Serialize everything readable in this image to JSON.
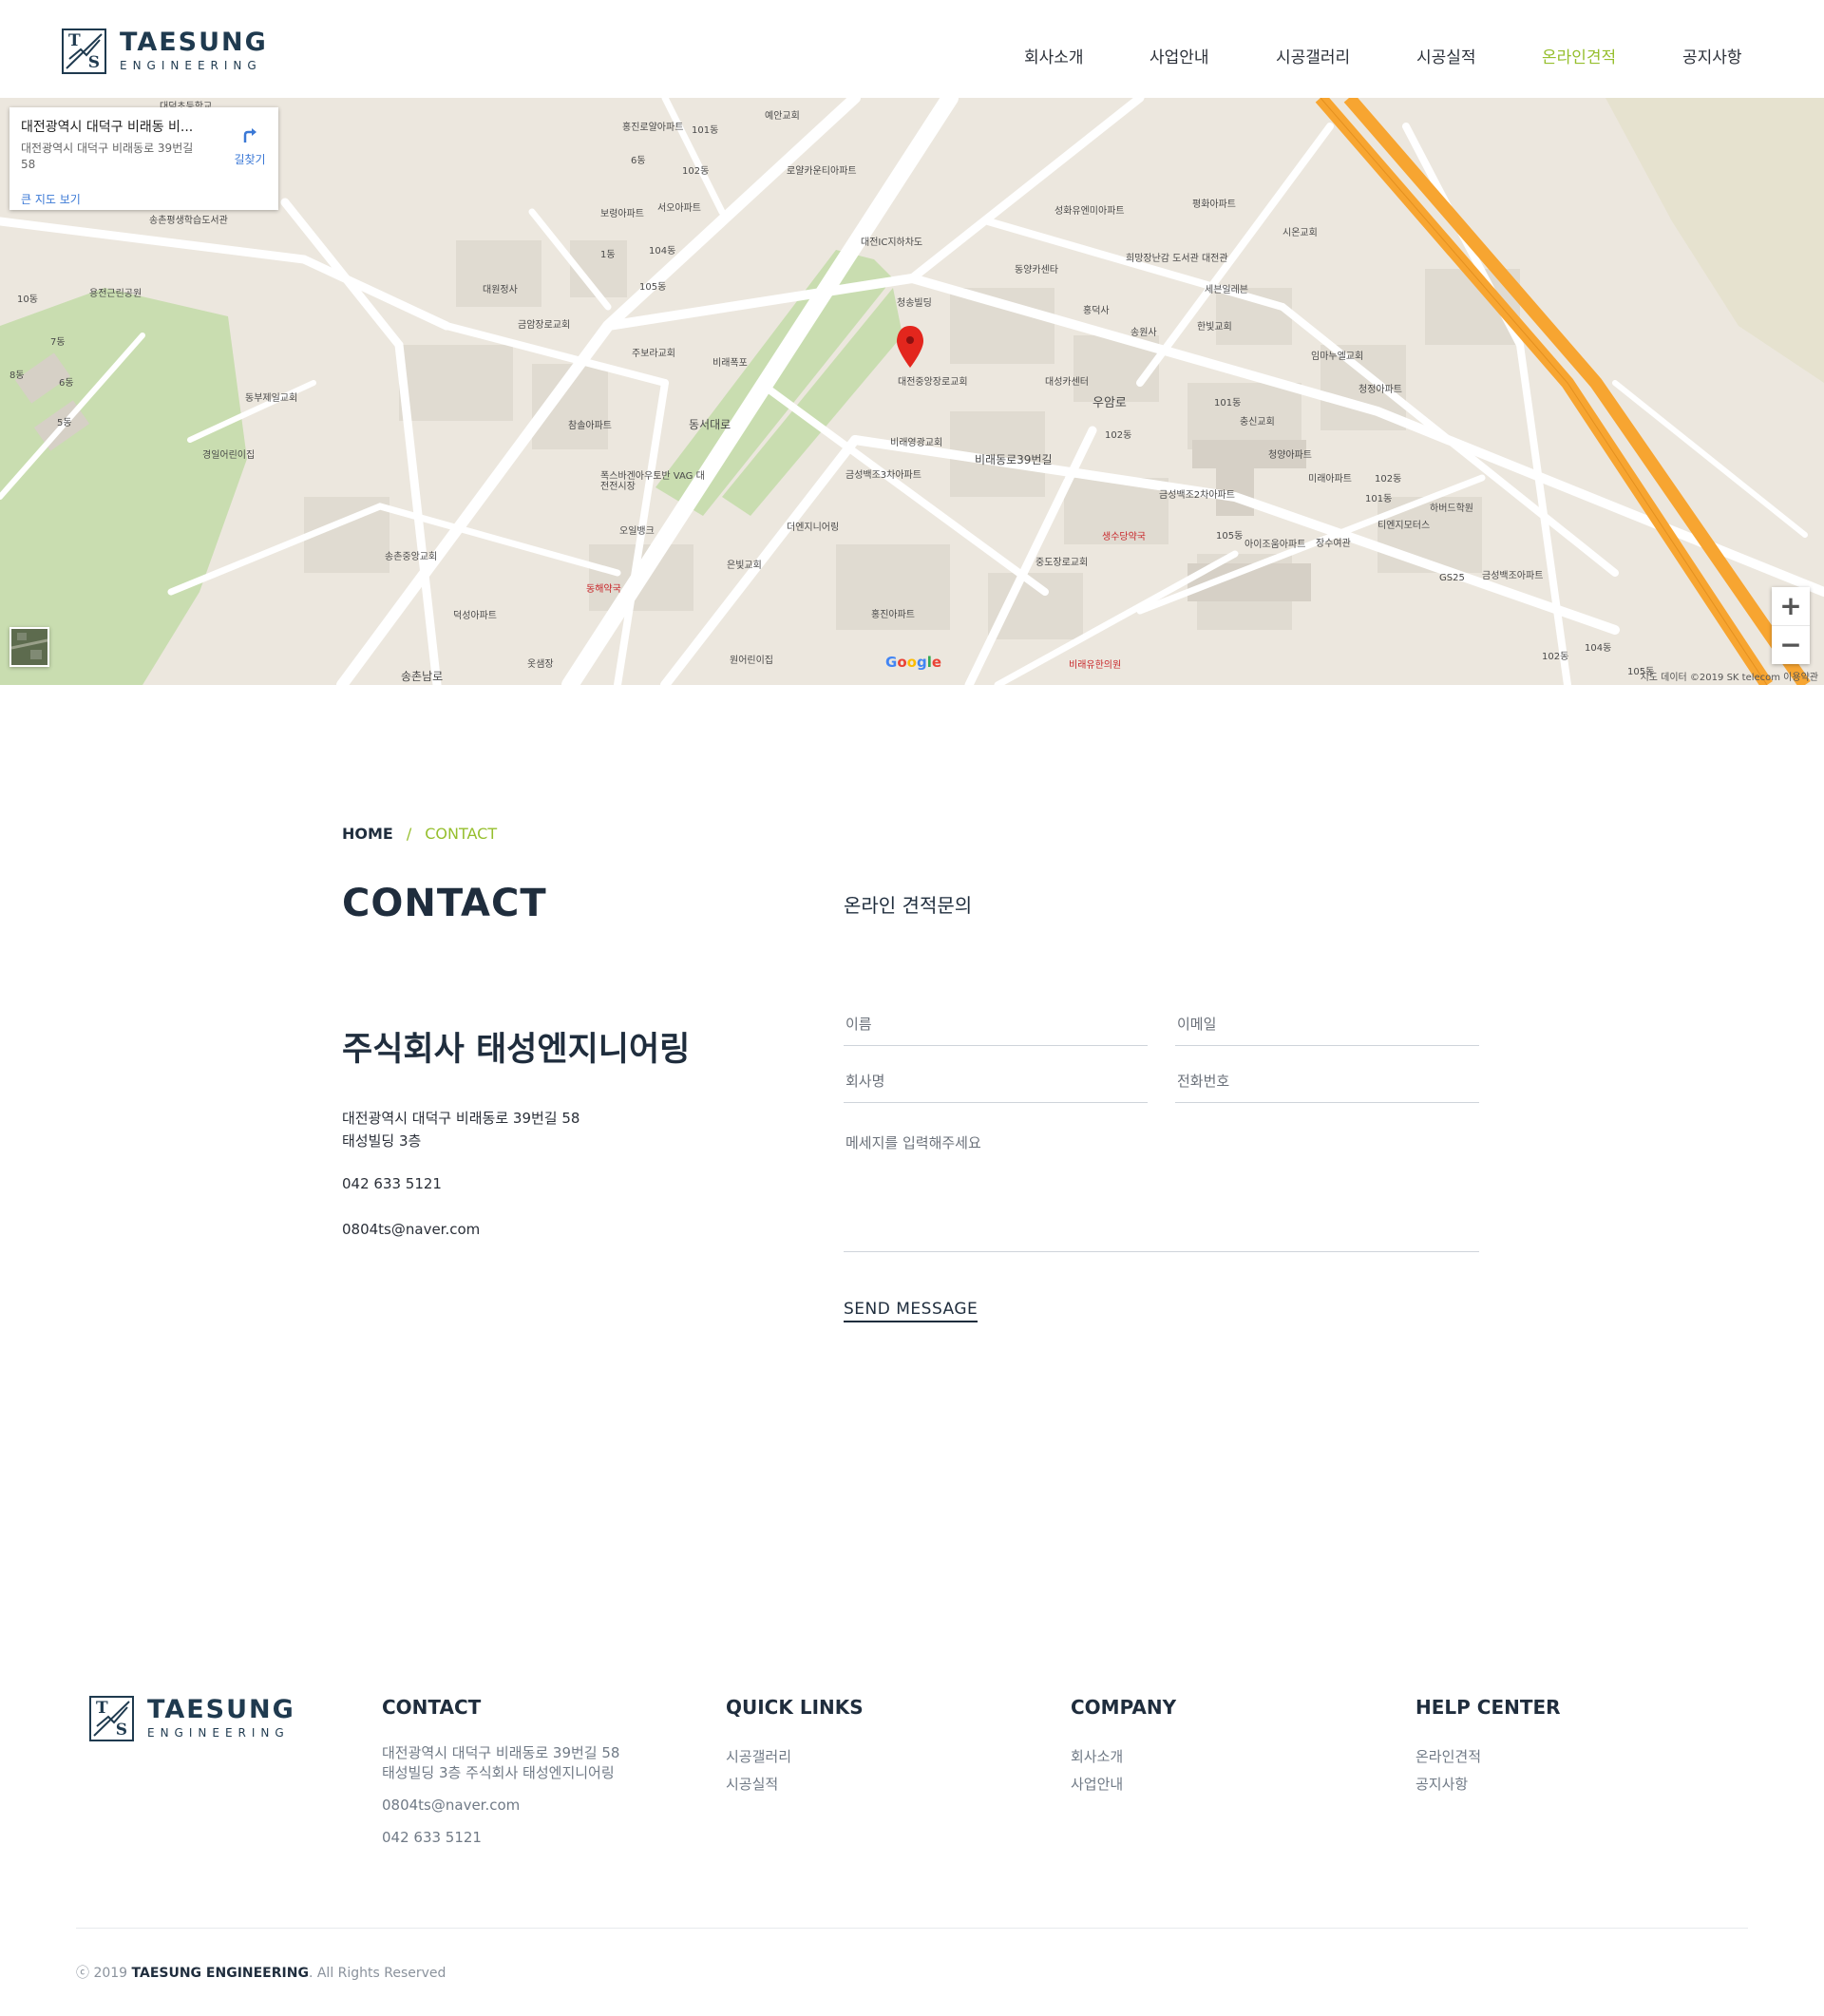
{
  "header": {
    "logo_title": "TAESUNG",
    "logo_sub": "ENGINEERING",
    "nav": [
      {
        "label": "회사소개",
        "active": false
      },
      {
        "label": "사업안내",
        "active": false
      },
      {
        "label": "시공갤러리",
        "active": false
      },
      {
        "label": "시공실적",
        "active": false
      },
      {
        "label": "온라인견적",
        "active": true
      },
      {
        "label": "공지사항",
        "active": false
      }
    ]
  },
  "map": {
    "info_title": "대전광역시 대덕구 비래동 비...",
    "info_address": "대전광역시 대덕구 비래동로 39번길 58",
    "directions_label": "길찾기",
    "big_map_label": "큰 지도 보기",
    "zoom_in": "+",
    "zoom_out": "−",
    "attribution": "지도 데이터 ©2019 SK telecom   이용약관",
    "google_logo": "Google",
    "labels": [
      "홍진로얄아파트",
      "101동",
      "예안교회",
      "로얄카운티아파트",
      "102동",
      "서오아파트",
      "보령아파트",
      "6동",
      "1동",
      "104동",
      "105동",
      "대원정사",
      "금암장로교회",
      "주보라교회",
      "비래폭포",
      "대전IC지하차도",
      "청송빌딩",
      "동양카센타",
      "홍덕사",
      "송원사",
      "한빛교회",
      "세븐일레븐",
      "희망장난감 도서관 대전관",
      "성화유엔미아파트",
      "평화아파트",
      "시온교회",
      "우암로",
      "대성카센터",
      "임마누엘교회",
      "청정아파트",
      "101동",
      "102동",
      "충신교회",
      "청양아파트",
      "미래아파트",
      "101동",
      "102동",
      "하버드학원",
      "티엔지모터스",
      "금성백조2차아파트",
      "105동",
      "아이조움아파트",
      "장수여관",
      "GS25",
      "금성백조아파트",
      "대전중앙장로교회",
      "비래영광교회",
      "금성백조3차아파트",
      "더엔지니어링",
      "생수당약국",
      "중도장로교회",
      "은빛교회",
      "홍진아파트",
      "원어린이집",
      "비래유한의원",
      "동해약국",
      "오일뱅크",
      "폭스바겐아우토반 VAG 대전전시장",
      "참솔아파트",
      "송촌중앙교회",
      "덕성아파트",
      "옷샘장",
      "동부제일교회",
      "경일어린이집",
      "송촌평생학습도서관",
      "용전근린공원",
      "10동",
      "7동",
      "6동",
      "5동",
      "8동",
      "104동",
      "102동",
      "105동",
      "대덕초등학교",
      "송촌남로",
      "동서대로",
      "비래동로39번길"
    ]
  },
  "contact": {
    "breadcrumb_home": "HOME",
    "breadcrumb_sep": "/",
    "breadcrumb_current": "CONTACT",
    "title": "CONTACT",
    "company_name": "주식회사 태성엔지니어링",
    "address_line1": "대전광역시 대덕구 비래동로 39번길 58",
    "address_line2": "태성빌딩 3층",
    "phone": "042 633 5121",
    "email": "0804ts@naver.com"
  },
  "form": {
    "title": "온라인 견적문의",
    "name_placeholder": "이름",
    "email_placeholder": "이메일",
    "company_placeholder": "회사명",
    "phone_placeholder": "전화번호",
    "message_placeholder": "메세지를 입력해주세요",
    "send_label": "SEND MESSAGE"
  },
  "footer": {
    "logo_title": "TAESUNG",
    "logo_sub": "ENGINEERING",
    "contact": {
      "heading": "CONTACT",
      "address_line1": "대전광역시 대덕구 비래동로 39번길 58",
      "address_line2": "태성빌딩 3층 주식회사 태성엔지니어링",
      "email": "0804ts@naver.com",
      "phone": "042 633 5121"
    },
    "quick_links": {
      "heading": "QUICK LINKS",
      "items": [
        "시공갤러리",
        "시공실적"
      ]
    },
    "company": {
      "heading": "COMPANY",
      "items": [
        "회사소개",
        "사업안내"
      ]
    },
    "help_center": {
      "heading": "HELP CENTER",
      "items": [
        "온라인견적",
        "공지사항"
      ]
    },
    "copyright_prefix": "ⓒ 2019 ",
    "copyright_brand": "TAESUNG ENGINEERING",
    "copyright_suffix": ". All Rights Reserved"
  },
  "colors": {
    "accent": "#96bf2e",
    "navy": "#1f2d3d",
    "highway": "#f7a531",
    "park": "#c9ddb0"
  }
}
